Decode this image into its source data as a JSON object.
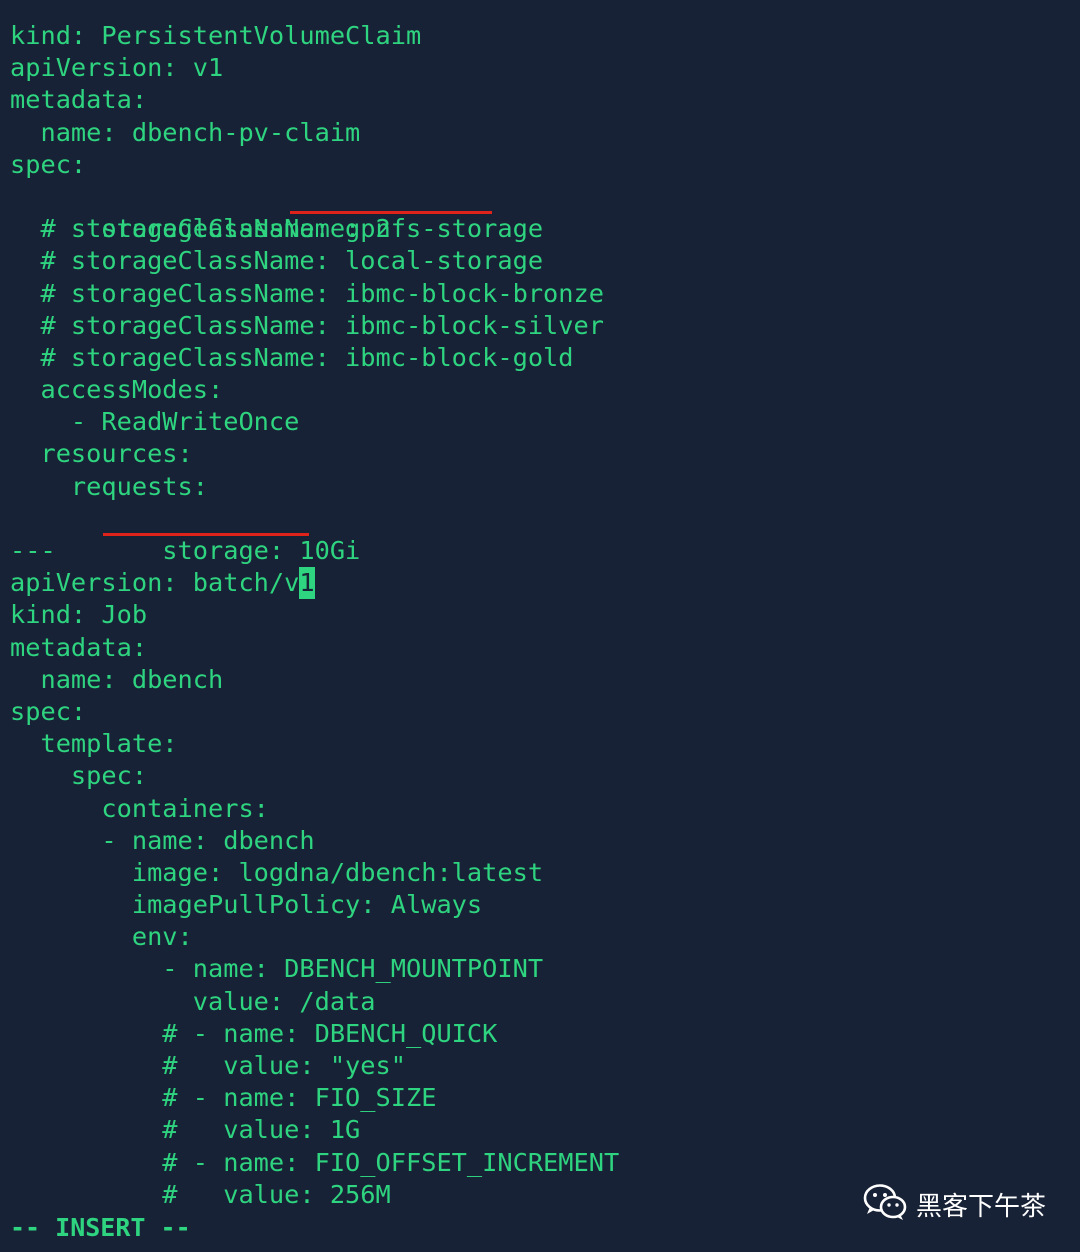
{
  "editor": {
    "lines": [
      "kind: PersistentVolumeClaim",
      "apiVersion: v1",
      "metadata:",
      "  name: dbench-pv-claim",
      "spec:",
      "  storageClassName: nfs-storage",
      "  # storageClassName: gp2",
      "  # storageClassName: local-storage",
      "  # storageClassName: ibmc-block-bronze",
      "  # storageClassName: ibmc-block-silver",
      "  # storageClassName: ibmc-block-gold",
      "  accessModes:",
      "    - ReadWriteOnce",
      "  resources:",
      "    requests:",
      "      storage: 10Gi",
      "---",
      "apiVersion: batch/v",
      "kind: Job",
      "metadata:",
      "  name: dbench",
      "spec:",
      "  template:",
      "    spec:",
      "      containers:",
      "      - name: dbench",
      "        image: logdna/dbench:latest",
      "        imagePullPolicy: Always",
      "        env:",
      "          - name: DBENCH_MOUNTPOINT",
      "            value: /data",
      "          # - name: DBENCH_QUICK",
      "          #   value: \"yes\"",
      "          # - name: FIO_SIZE",
      "          #   value: 1G",
      "          # - name: FIO_OFFSET_INCREMENT",
      "          #   value: 256M"
    ],
    "cursor_char": "1",
    "cursor_line": 17
  },
  "status": {
    "mode": "-- INSERT --"
  },
  "watermark": {
    "text": "黑客下午茶",
    "icon": "wechat-icon"
  },
  "colors": {
    "background": "#182236",
    "text": "#2ed47f",
    "highlight": "#e0231a"
  }
}
